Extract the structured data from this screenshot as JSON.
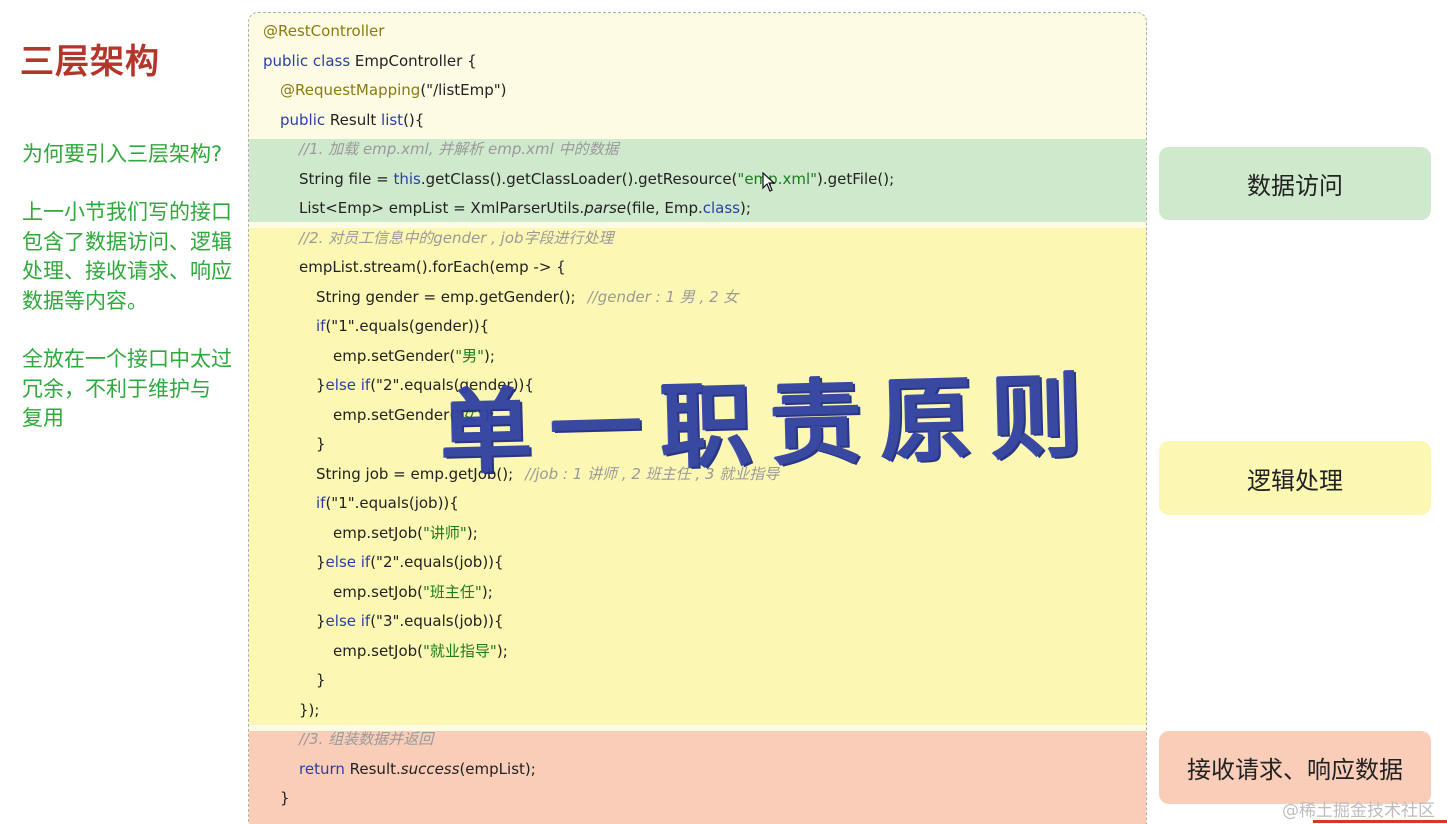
{
  "slide": {
    "title": "三层架构",
    "question": "为何要引入三层架构?",
    "para1": [
      "上一小节我们写的接口",
      "包含了数据访问、逻辑",
      "处理、接收请求、响应",
      "数据等内容。"
    ],
    "para2": [
      "全放在一个接口中太过",
      "冗余，不利于维护与",
      "复用"
    ]
  },
  "code": {
    "l1": "@RestController",
    "l2_k": "public class",
    "l2_rest": " EmpController {",
    "l3_a": "@RequestMapping",
    "l3_rest": "(\"/listEmp\")",
    "l4_k": "public",
    "l4_mid": " Result ",
    "l4_m": "list",
    "l4_rest": "(){",
    "l5": "//1. 加载 emp.xml, 并解析 emp.xml 中的数据",
    "l6_a": "String file = ",
    "l6_k": "this",
    "l6_b": ".getClass().getClassLoader().getResource(",
    "l6_s": "\"emp.xml\"",
    "l6_c": ").getFile();",
    "l7_a": "List<Emp> empList = XmlParserUtils.",
    "l7_i": "parse",
    "l7_b": "(file, Emp.",
    "l7_k": "class",
    "l7_c": ");",
    "l8": "//2. 对员工信息中的gender , job字段进行处理",
    "l9": "empList.stream().forEach(emp -> {",
    "l10_a": "String gender = emp.getGender();",
    "l10_c": "//gender : 1 男 , 2 女",
    "l11_k": "if",
    "l11_rest": "(\"1\".equals(gender)){",
    "l12_a": "emp.setGender(",
    "l12_s": "\"男\"",
    "l12_b": ");",
    "l13_a": "}",
    "l13_k": "else if",
    "l13_rest": "(\"2\".equals(gender)){",
    "l14_a": "emp.setGender(",
    "l14_s": "\"女\"",
    "l14_b": ");",
    "l15": "}",
    "l16_a": "String job = emp.getJob();",
    "l16_c": "//job : 1 讲师 , 2 班主任 , 3 就业指导",
    "l17_k": "if",
    "l17_rest": "(\"1\".equals(job)){",
    "l18_a": "emp.setJob(",
    "l18_s": "\"讲师\"",
    "l18_b": ");",
    "l19_a": "}",
    "l19_k": "else if",
    "l19_rest": "(\"2\".equals(job)){",
    "l20_a": "emp.setJob(",
    "l20_s": "\"班主任\"",
    "l20_b": ");",
    "l21_a": "}",
    "l21_k": "else if",
    "l21_rest": "(\"3\".equals(job)){",
    "l22_a": "emp.setJob(",
    "l22_s": "\"就业指导\"",
    "l22_b": ");",
    "l23": "}",
    "l24": "});",
    "l25": "//3. 组装数据并返回",
    "l26_k": "return",
    "l26_a": " Result.",
    "l26_i": "success",
    "l26_b": "(empList);",
    "l27": "}"
  },
  "stamp_text": "单一职责原则",
  "labels": {
    "data_access": "数据访问",
    "logic": "逻辑处理",
    "request_response": "接收请求、响应数据"
  },
  "watermark": "@稀土掘金技术社区",
  "colors": {
    "title": "#b4352b",
    "left_text": "#2fa83c",
    "data_band": "#cfe9cd",
    "logic_band": "#fcf7b3",
    "response_band": "#f9cdb8",
    "stamp": "#2f3fa0"
  },
  "icons": [
    "mouse-cursor-icon"
  ]
}
